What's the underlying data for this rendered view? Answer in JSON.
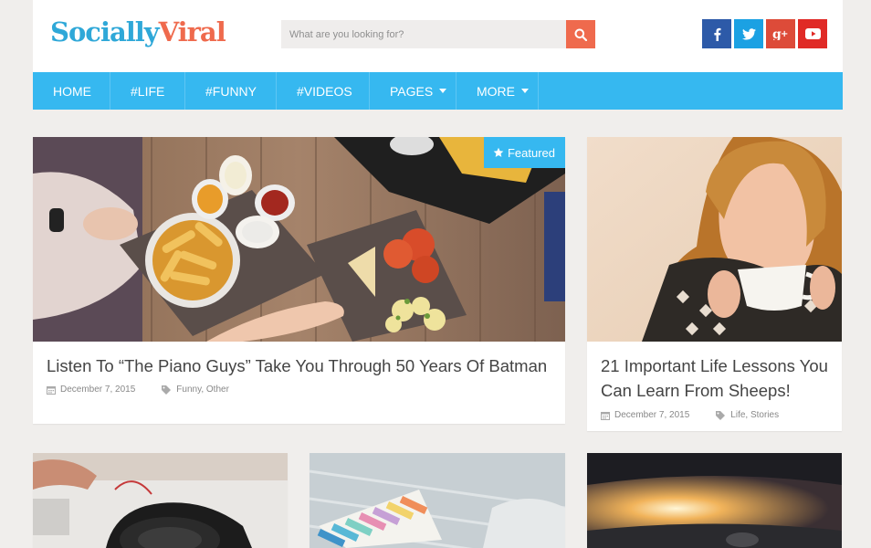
{
  "site": {
    "logo_part1": "Socially",
    "logo_part2": "Viral"
  },
  "search": {
    "placeholder": "What are you looking for?"
  },
  "social": [
    {
      "name": "facebook",
      "glyph": "f"
    },
    {
      "name": "twitter",
      "glyph": "t"
    },
    {
      "name": "google-plus",
      "glyph": "g+"
    },
    {
      "name": "youtube",
      "glyph": "yt"
    }
  ],
  "nav": {
    "items": [
      {
        "label": "HOME"
      },
      {
        "label": "#LIFE"
      },
      {
        "label": "#FUNNY"
      },
      {
        "label": "#VIDEOS"
      },
      {
        "label": "PAGES"
      },
      {
        "label": "MORE"
      }
    ]
  },
  "posts": [
    {
      "title": "Listen To “The Piano Guys” Take You Through 50 Years Of Batman",
      "date": "December 7, 2015",
      "categories": "Funny, Other",
      "badge": "Featured"
    },
    {
      "title": "21 Important Life Lessons You Can Learn From Sheeps!",
      "date": "December 7, 2015",
      "categories": "Life, Stories"
    }
  ],
  "colors": {
    "accent": "#36b8f0",
    "brand_orange": "#ef6a4d",
    "background": "#f0eeec"
  }
}
